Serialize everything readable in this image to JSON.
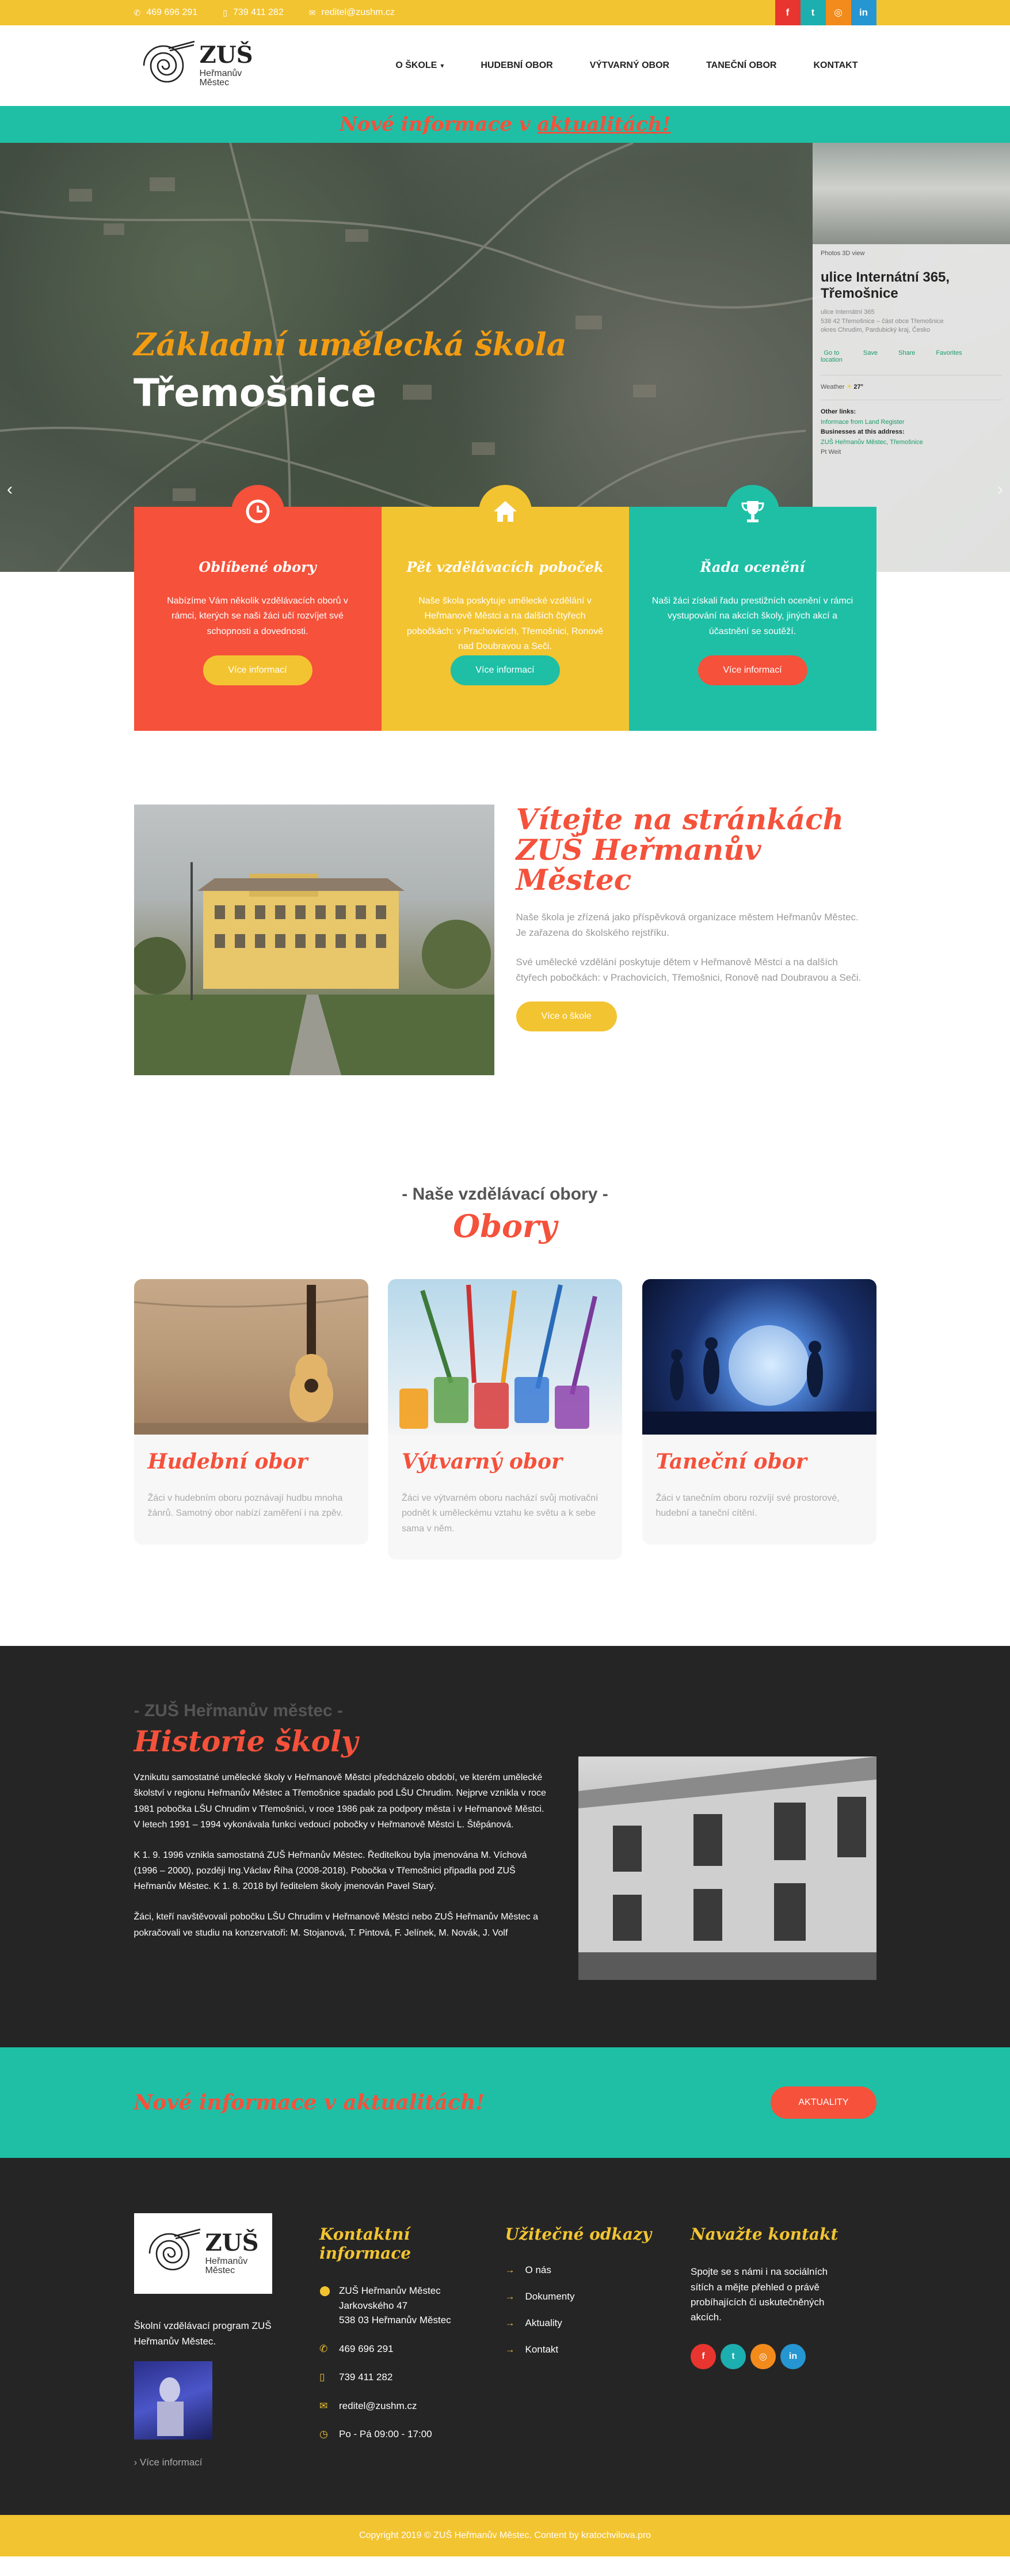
{
  "topbar": {
    "phone1": "469 696 291",
    "phone2": "739 411 282",
    "email": "reditel@zushm.cz",
    "socials": [
      {
        "label": "f",
        "color": "#e8352f"
      },
      {
        "label": "t",
        "color": "#1daeb0"
      },
      {
        "label": "◎",
        "color": "#f28b1c"
      },
      {
        "label": "in",
        "color": "#2596d1"
      }
    ]
  },
  "logo": {
    "title": "ZUŠ",
    "line1": "Heřmanův",
    "line2": "Městec"
  },
  "nav": [
    {
      "label": "O ŠKOLE",
      "dropdown": "▾"
    },
    {
      "label": "HUDEBNÍ OBOR"
    },
    {
      "label": "VÝTVARNÝ OBOR"
    },
    {
      "label": "TANEČNÍ OBOR"
    },
    {
      "label": "KONTAKT"
    }
  ],
  "newsbar": {
    "prefix": "Nové informace v ",
    "link": "aktualitách!"
  },
  "hero": {
    "subtitle": "Základní umělecká škola",
    "title": "Třemošnice",
    "prev": "‹",
    "next": "›",
    "map": {
      "top_links": "Photos    3D view",
      "address_title": "ulice Internátní 365, Třemošnice",
      "address_detail": "ulice Internátní 365\n538 42  Třemošnice – část obce Třemošnice\nokres Chrudim, Pardubický kraj, Česko",
      "actions": [
        "Go to\nlocation",
        "Save",
        "Share",
        "Favorites"
      ],
      "weather_label": "Weather",
      "weather_value": "27°",
      "other_label": "Other links:",
      "other_value": "Informace from Land Register",
      "biz_label": "Businesses at this address:",
      "biz_value": "ZUŠ Heřmanův Městec, Třemošnice",
      "foot": "Pt  Weit"
    }
  },
  "features": [
    {
      "title": "Oblíbené obory",
      "text": "Nabízíme Vám několik vzdělávacích oborů v rámci, kterých se naši žáci učí rozvíjet své schopnosti a dovednosti.",
      "button": "Více informací",
      "bg": "#f5513b",
      "btn_bg": "#f3c431",
      "icon": "clock"
    },
    {
      "title": "Pět vzdělávacích poboček",
      "text": "Naše škola poskytuje umělecké vzdělání v Heřmanově Městci a na dalších čtyřech pobočkách: v Prachovicích, Třemošnici, Ronově nad Doubravou a Seči.",
      "button": "Více informací",
      "bg": "#f3c431",
      "btn_bg": "#1fbfa6",
      "icon": "home"
    },
    {
      "title": "Řada ocenění",
      "text": "Naši žáci získali řadu prestižních ocenění v rámci vystupování na akcích školy, jiných akcí a účastnění se soutěží.",
      "button": "Více informací",
      "bg": "#1fbfa6",
      "btn_bg": "#f5513b",
      "icon": "trophy"
    }
  ],
  "welcome": {
    "title": "Vítejte na stránkách ZUŠ Heřmanův Městec",
    "p1": "Naše škola je zřízená jako příspěvková organizace městem Heřmanův Městec. Je zařazena do školského rejstříku.",
    "p2": "Své umělecké vzdělání poskytuje dětem v Heřmanově Městci a na dalších čtyřech pobočkách: v Prachovicích, Třemošnici, Ronově nad Doubravou a Seči.",
    "button": "Více o škole"
  },
  "obory": {
    "pre": "- Naše vzdělávací obory -",
    "title": "Obory",
    "cards": [
      {
        "title": "Hudební obor",
        "text": "Žáci v hudebním oboru poznávají hudbu mnoha žánrů. Samotný obor nabízí zaměření i na zpěv."
      },
      {
        "title": "Výtvarný obor",
        "text": "Žáci ve výtvarném oboru nachází svůj motivační podnět k uměleckému vztahu ke světu a k sebe sama v něm."
      },
      {
        "title": "Taneční obor",
        "text": "Žáci v tanečním oboru rozvíjí své prostorové, hudební a taneční cítění."
      }
    ]
  },
  "history": {
    "pre": "- ZUŠ Heřmanův městec -",
    "title": "Historie školy",
    "p1": "Vznikutu samostatné umělecké školy v Heřmanově Městci předcházelo období, ve kterém umělecké školství v regionu Heřmanův Městec a Třemošnice spadalo pod LŠU Chrudim. Nejprve vznikla v roce 1981 pobočka LŠU Chrudim v Třemošnici, v roce 1986 pak za podpory města i v Heřmanově Městci. V letech 1991 – 1994 vykonávala funkci vedoucí pobočky v Heřmanově Městci L. Štěpánová.",
    "p2": "K 1. 9. 1996 vznikla samostatná ZUŠ Heřmanův Městec. Ředitelkou byla jmenována M. Víchová (1996 – 2000), později Ing.Václav Říha (2008-2018). Pobočka v Třemošnici připadla pod ZUŠ Heřmanův Městec. K 1. 8. 2018 byl ředitelem školy jmenován Pavel Starý.",
    "p3": "Žáci, kteří navštěvovali pobočku LŠU Chrudim v Heřmanově Městci nebo ZUŠ Heřmanův Městec a pokračovali ve studiu na konzervatoři: M. Stojanová, T. Pintová, F. Jelínek, M. Novák, J. Volf"
  },
  "newsband": {
    "title": "Nové informace v aktualitách!",
    "button": "AKTUALITY"
  },
  "footer": {
    "desc": "Školní vzdělávací program ZUŠ Heřmanův Městec.",
    "more": "› Více informací",
    "contact_title": "Kontaktní informace",
    "address": "ZUŠ Heřmanův Městec\nJarkovského 47\n538 03 Heřmanův Městec",
    "phone1": "469 696 291",
    "phone2": "739 411 282",
    "email": "reditel@zushm.cz",
    "hours": "Po - Pá 09:00 - 17:00",
    "links_title": "Užitečné odkazy",
    "links": [
      "O nás",
      "Dokumenty",
      "Aktuality",
      "Kontakt"
    ],
    "social_title": "Navažte kontakt",
    "social_text": "Spojte se s námi i na sociálních sítích a mějte přehled o právě probíhajících či uskutečněných akcích.",
    "copyright": "Copyright 2019 © ZUŠ Heřmanův Městec. Content by kratochvilova.pro"
  }
}
